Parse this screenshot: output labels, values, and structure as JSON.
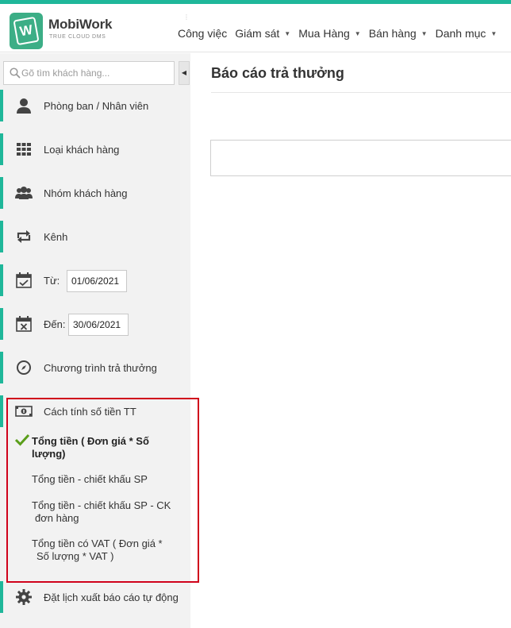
{
  "brand": {
    "name": "MobiWork",
    "tagline": "TRUE CLOUD DMS",
    "logo_letter": "W",
    "color": "#3cae86",
    "accent": "#1fb79a"
  },
  "nav": [
    {
      "label": "Công việc",
      "has_dropdown": false
    },
    {
      "label": "Giám sát",
      "has_dropdown": true
    },
    {
      "label": "Mua Hàng",
      "has_dropdown": true
    },
    {
      "label": "Bán hàng",
      "has_dropdown": true
    },
    {
      "label": "Danh mục",
      "has_dropdown": true
    }
  ],
  "sidebar": {
    "search_placeholder": "Gõ tìm khách hàng...",
    "items": [
      {
        "label": "Phòng ban / Nhân viên",
        "icon": "user-icon"
      },
      {
        "label": "Loại khách hàng",
        "icon": "grid-icon"
      },
      {
        "label": "Nhóm khách hàng",
        "icon": "users-group-icon"
      },
      {
        "label": "Kênh",
        "icon": "retweet-icon"
      }
    ],
    "date_from": {
      "label": "Từ:",
      "value": "01/06/2021",
      "icon": "calendar-check-icon"
    },
    "date_to": {
      "label": "Đến:",
      "value": "30/06/2021",
      "icon": "calendar-x-icon"
    },
    "program": {
      "label": "Chương trình trả thưởng",
      "icon": "compass-icon"
    },
    "calc": {
      "label": "Cách tính số tiền TT",
      "icon": "money-icon",
      "options": [
        {
          "line1": "Tổng tiền ( Đơn giá * Số",
          "line2": "lượng)",
          "selected": true
        },
        {
          "line1": "Tổng tiền - chiết khấu SP",
          "line2": "",
          "selected": false
        },
        {
          "line1": "Tổng tiền - chiết khấu SP - CK",
          "line2": "đơn hàng",
          "selected": false
        },
        {
          "line1": "Tổng tiền có VAT ( Đơn giá *",
          "line2": "Số lượng * VAT )",
          "selected": false
        }
      ]
    },
    "schedule": {
      "label": "Đặt lịch xuất báo cáo tự động",
      "icon": "gear-icon"
    }
  },
  "main": {
    "title": "Báo cáo trả thưởng"
  },
  "highlight_color": "#d0021b"
}
